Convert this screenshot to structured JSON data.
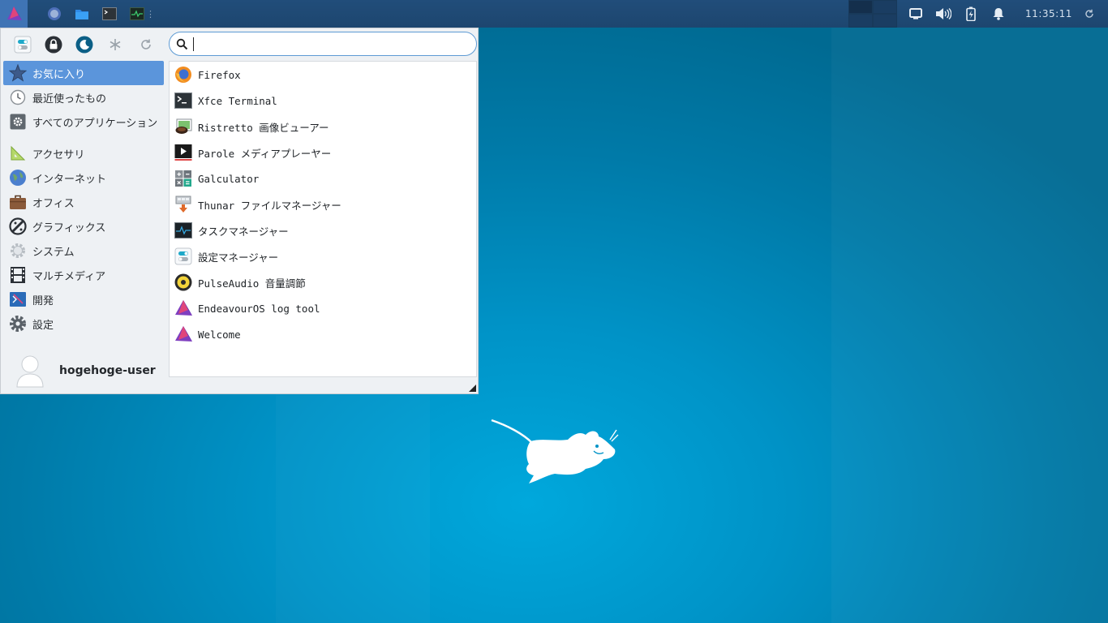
{
  "panel": {
    "menu_button_icon": "endeavouros-logo-icon",
    "launchers": [
      {
        "name": "firefox-launcher",
        "icon": "firefox-icon"
      },
      {
        "name": "file-manager-launcher",
        "icon": "folder-icon"
      },
      {
        "name": "terminal-launcher",
        "icon": "terminal-icon"
      },
      {
        "name": "task-manager-launcher",
        "icon": "task-manager-icon"
      }
    ],
    "clock": "11:35:11",
    "tray_icons": [
      "display-icon",
      "volume-icon",
      "battery-charging-icon",
      "notification-bell-icon"
    ]
  },
  "whisker": {
    "search": {
      "placeholder": "",
      "value": ""
    },
    "quick_actions": [
      "settings-icon",
      "lock-icon",
      "logout-icon",
      "switch-user-icon",
      "refresh-icon"
    ],
    "categories": [
      {
        "label": "お気に入り",
        "icon": "star-icon",
        "active": true
      },
      {
        "label": "最近使ったもの",
        "icon": "clock-icon"
      },
      {
        "label": "すべてのアプリケーション",
        "icon": "gear-box-icon"
      },
      {
        "label": "アクセサリ",
        "icon": "ruler-icon"
      },
      {
        "label": "インターネット",
        "icon": "globe-icon"
      },
      {
        "label": "オフィス",
        "icon": "briefcase-icon"
      },
      {
        "label": "グラフィックス",
        "icon": "palette-icon"
      },
      {
        "label": "システム",
        "icon": "cog-icon"
      },
      {
        "label": "マルチメディア",
        "icon": "film-icon"
      },
      {
        "label": "開発",
        "icon": "dev-icon"
      },
      {
        "label": "設定",
        "icon": "settings-gear-icon"
      }
    ],
    "apps": [
      {
        "label": "Firefox",
        "icon": "firefox-icon"
      },
      {
        "label": "Xfce Terminal",
        "icon": "terminal-icon"
      },
      {
        "label": "Ristretto 画像ビューアー",
        "icon": "image-viewer-icon"
      },
      {
        "label": "Parole メディアプレーヤー",
        "icon": "media-player-icon"
      },
      {
        "label": "Galculator",
        "icon": "calculator-icon"
      },
      {
        "label": "Thunar ファイルマネージャー",
        "icon": "file-manager-icon"
      },
      {
        "label": "タスクマネージャー",
        "icon": "task-manager-icon"
      },
      {
        "label": "設定マネージャー",
        "icon": "settings-manager-icon"
      },
      {
        "label": "PulseAudio 音量調節",
        "icon": "volume-control-icon"
      },
      {
        "label": "EndeavourOS log tool",
        "icon": "endeavouros-icon"
      },
      {
        "label": "Welcome",
        "icon": "endeavouros-icon"
      }
    ],
    "user": {
      "name": "hogehoge-user",
      "icon": "avatar-icon"
    }
  },
  "desktop": {
    "logo": "xfce-mouse-logo"
  },
  "colors": {
    "accent": "#5b95db",
    "panel": "#1d466f",
    "desktop": "#0093c7"
  }
}
